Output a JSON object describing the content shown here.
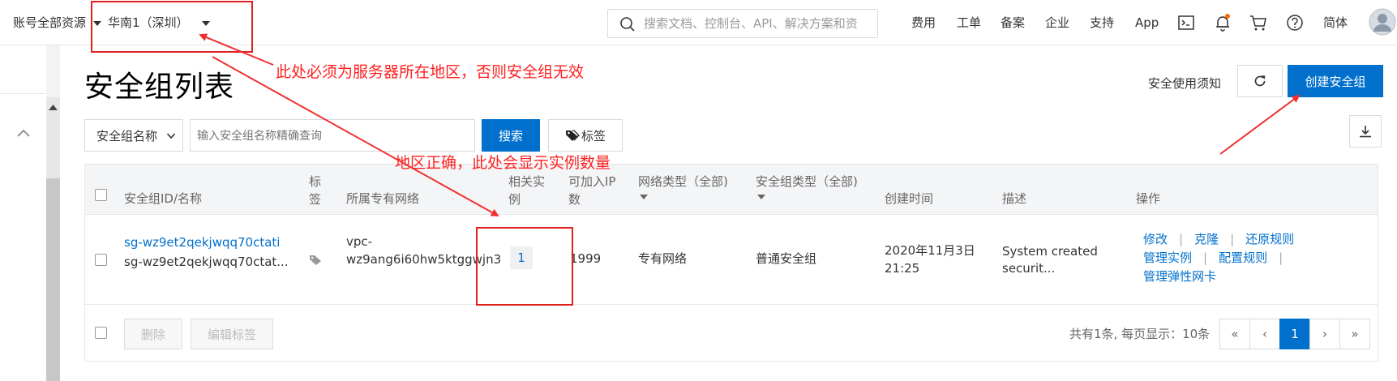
{
  "topbar": {
    "account_scope": "账号全部资源",
    "region": "华南1（深圳）",
    "search_placeholder": "搜索文档、控制台、API、解决方案和资",
    "nav": [
      "费用",
      "工单",
      "备案",
      "企业",
      "支持",
      "App"
    ],
    "language": "简体"
  },
  "page": {
    "title": "安全组列表",
    "security_notice": "安全使用须知",
    "create_button": "创建安全组"
  },
  "filter": {
    "field_select": "安全组名称",
    "search_placeholder": "输入安全组名称精确查询",
    "search_button": "搜索",
    "tag_button": "标签"
  },
  "table": {
    "headers": {
      "id_name": "安全组ID/名称",
      "tag": "标签",
      "vpc": "所属专有网络",
      "instances": "相关实例",
      "available_ip": "可加入IP数",
      "network_type": "网络类型（全部)",
      "group_type": "安全组类型（全部)",
      "created": "创建时间",
      "description": "描述",
      "actions": "操作"
    },
    "rows": [
      {
        "id": "sg-wz9et2qekjwqq70ctati",
        "name": "sg-wz9et2qekjwqq70ctat...",
        "vpc_line1": "vpc-",
        "vpc_line2": "wz9ang6i60hw5ktggwjn3",
        "instances": "1",
        "available_ip": "1999",
        "network_type": "专有网络",
        "group_type": "普通安全组",
        "created_line1": "2020年11月3日",
        "created_line2": "21:25",
        "description_line1": "System created",
        "description_line2": "securit...",
        "actions": [
          "修改",
          "克隆",
          "还原规则",
          "管理实例",
          "配置规则",
          "管理弹性网卡"
        ]
      }
    ]
  },
  "footer": {
    "delete_button": "删除",
    "edit_tags_button": "编辑标签",
    "summary": "共有1条, 每页显示：10条",
    "pager": [
      "«",
      "‹",
      "1",
      "›",
      "»"
    ]
  },
  "annotations": {
    "region_note": "此处必须为服务器所在地区，否则安全组无效",
    "instance_note": "地区正确，此处会显示实例数量"
  },
  "colors": {
    "primary": "#0070cc",
    "annotation": "#ff2020"
  }
}
